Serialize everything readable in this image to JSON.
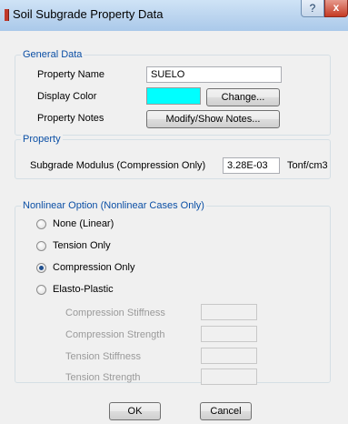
{
  "window": {
    "title": "Soil Subgrade Property Data",
    "help_glyph": "?",
    "close_glyph": "x"
  },
  "general": {
    "legend": "General Data",
    "property_name_label": "Property Name",
    "property_name_value": "SUELO",
    "display_color_label": "Display Color",
    "display_color_value": "#00ffff",
    "change_button": "Change...",
    "property_notes_label": "Property Notes",
    "notes_button": "Modify/Show Notes..."
  },
  "property": {
    "legend": "Property",
    "modulus_label": "Subgrade Modulus  (Compression Only)",
    "modulus_value": "3.28E-03",
    "modulus_units": "Tonf/cm3"
  },
  "nonlinear": {
    "legend": "Nonlinear Option  (Nonlinear Cases Only)",
    "options": [
      {
        "label": "None (Linear)",
        "selected": false
      },
      {
        "label": "Tension Only",
        "selected": false
      },
      {
        "label": "Compression Only",
        "selected": true
      },
      {
        "label": "Elasto-Plastic",
        "selected": false
      }
    ],
    "fields": [
      {
        "label": "Compression Stiffness",
        "value": ""
      },
      {
        "label": "Compression Strength",
        "value": ""
      },
      {
        "label": "Tension Stiffness",
        "value": ""
      },
      {
        "label": "Tension Strength",
        "value": ""
      }
    ]
  },
  "footer": {
    "ok": "OK",
    "cancel": "Cancel"
  }
}
